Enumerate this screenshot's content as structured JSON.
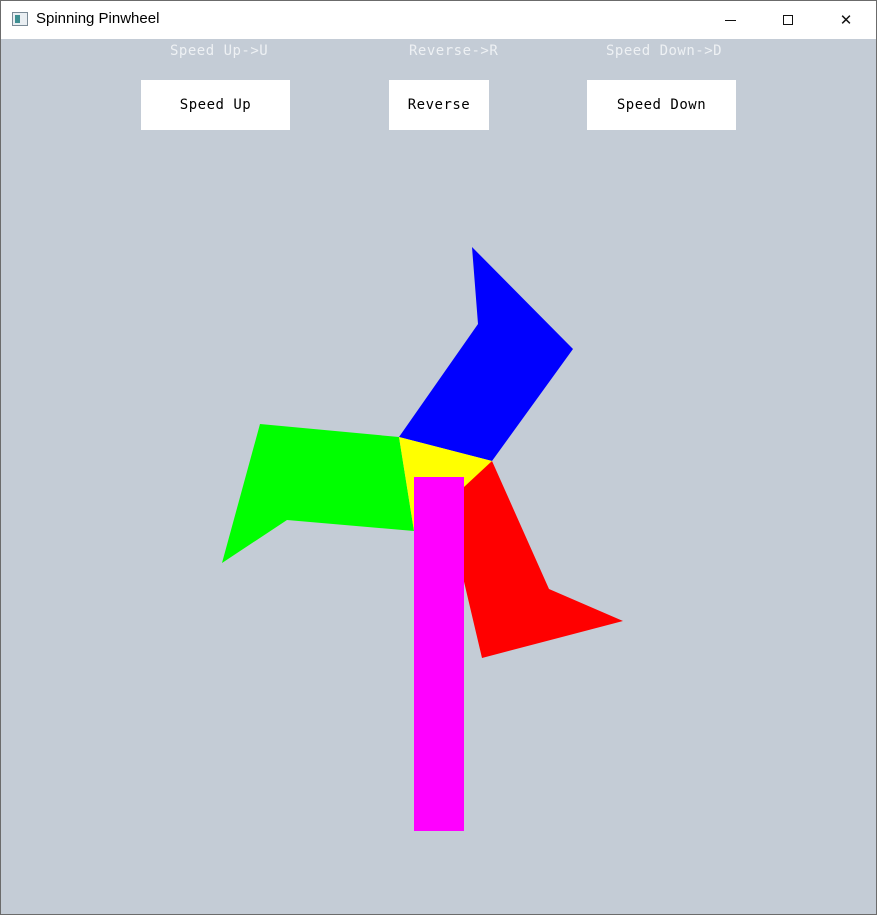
{
  "window": {
    "title": "Spinning Pinwheel",
    "controls": {
      "minimize": "minimize",
      "maximize": "maximize",
      "close": "✕"
    }
  },
  "hints": {
    "speed_up": "Speed Up->U",
    "reverse": "Reverse->R",
    "speed_down": "Speed Down->D"
  },
  "buttons": {
    "speed_up": "Speed Up",
    "reverse": "Reverse",
    "speed_down": "Speed Down"
  },
  "colors": {
    "background": "#c4ccd6",
    "blade_blue": "#0000ff",
    "blade_green": "#00ff00",
    "blade_red": "#ff0000",
    "hub": "#ffff00",
    "stick": "#ff00ff"
  }
}
